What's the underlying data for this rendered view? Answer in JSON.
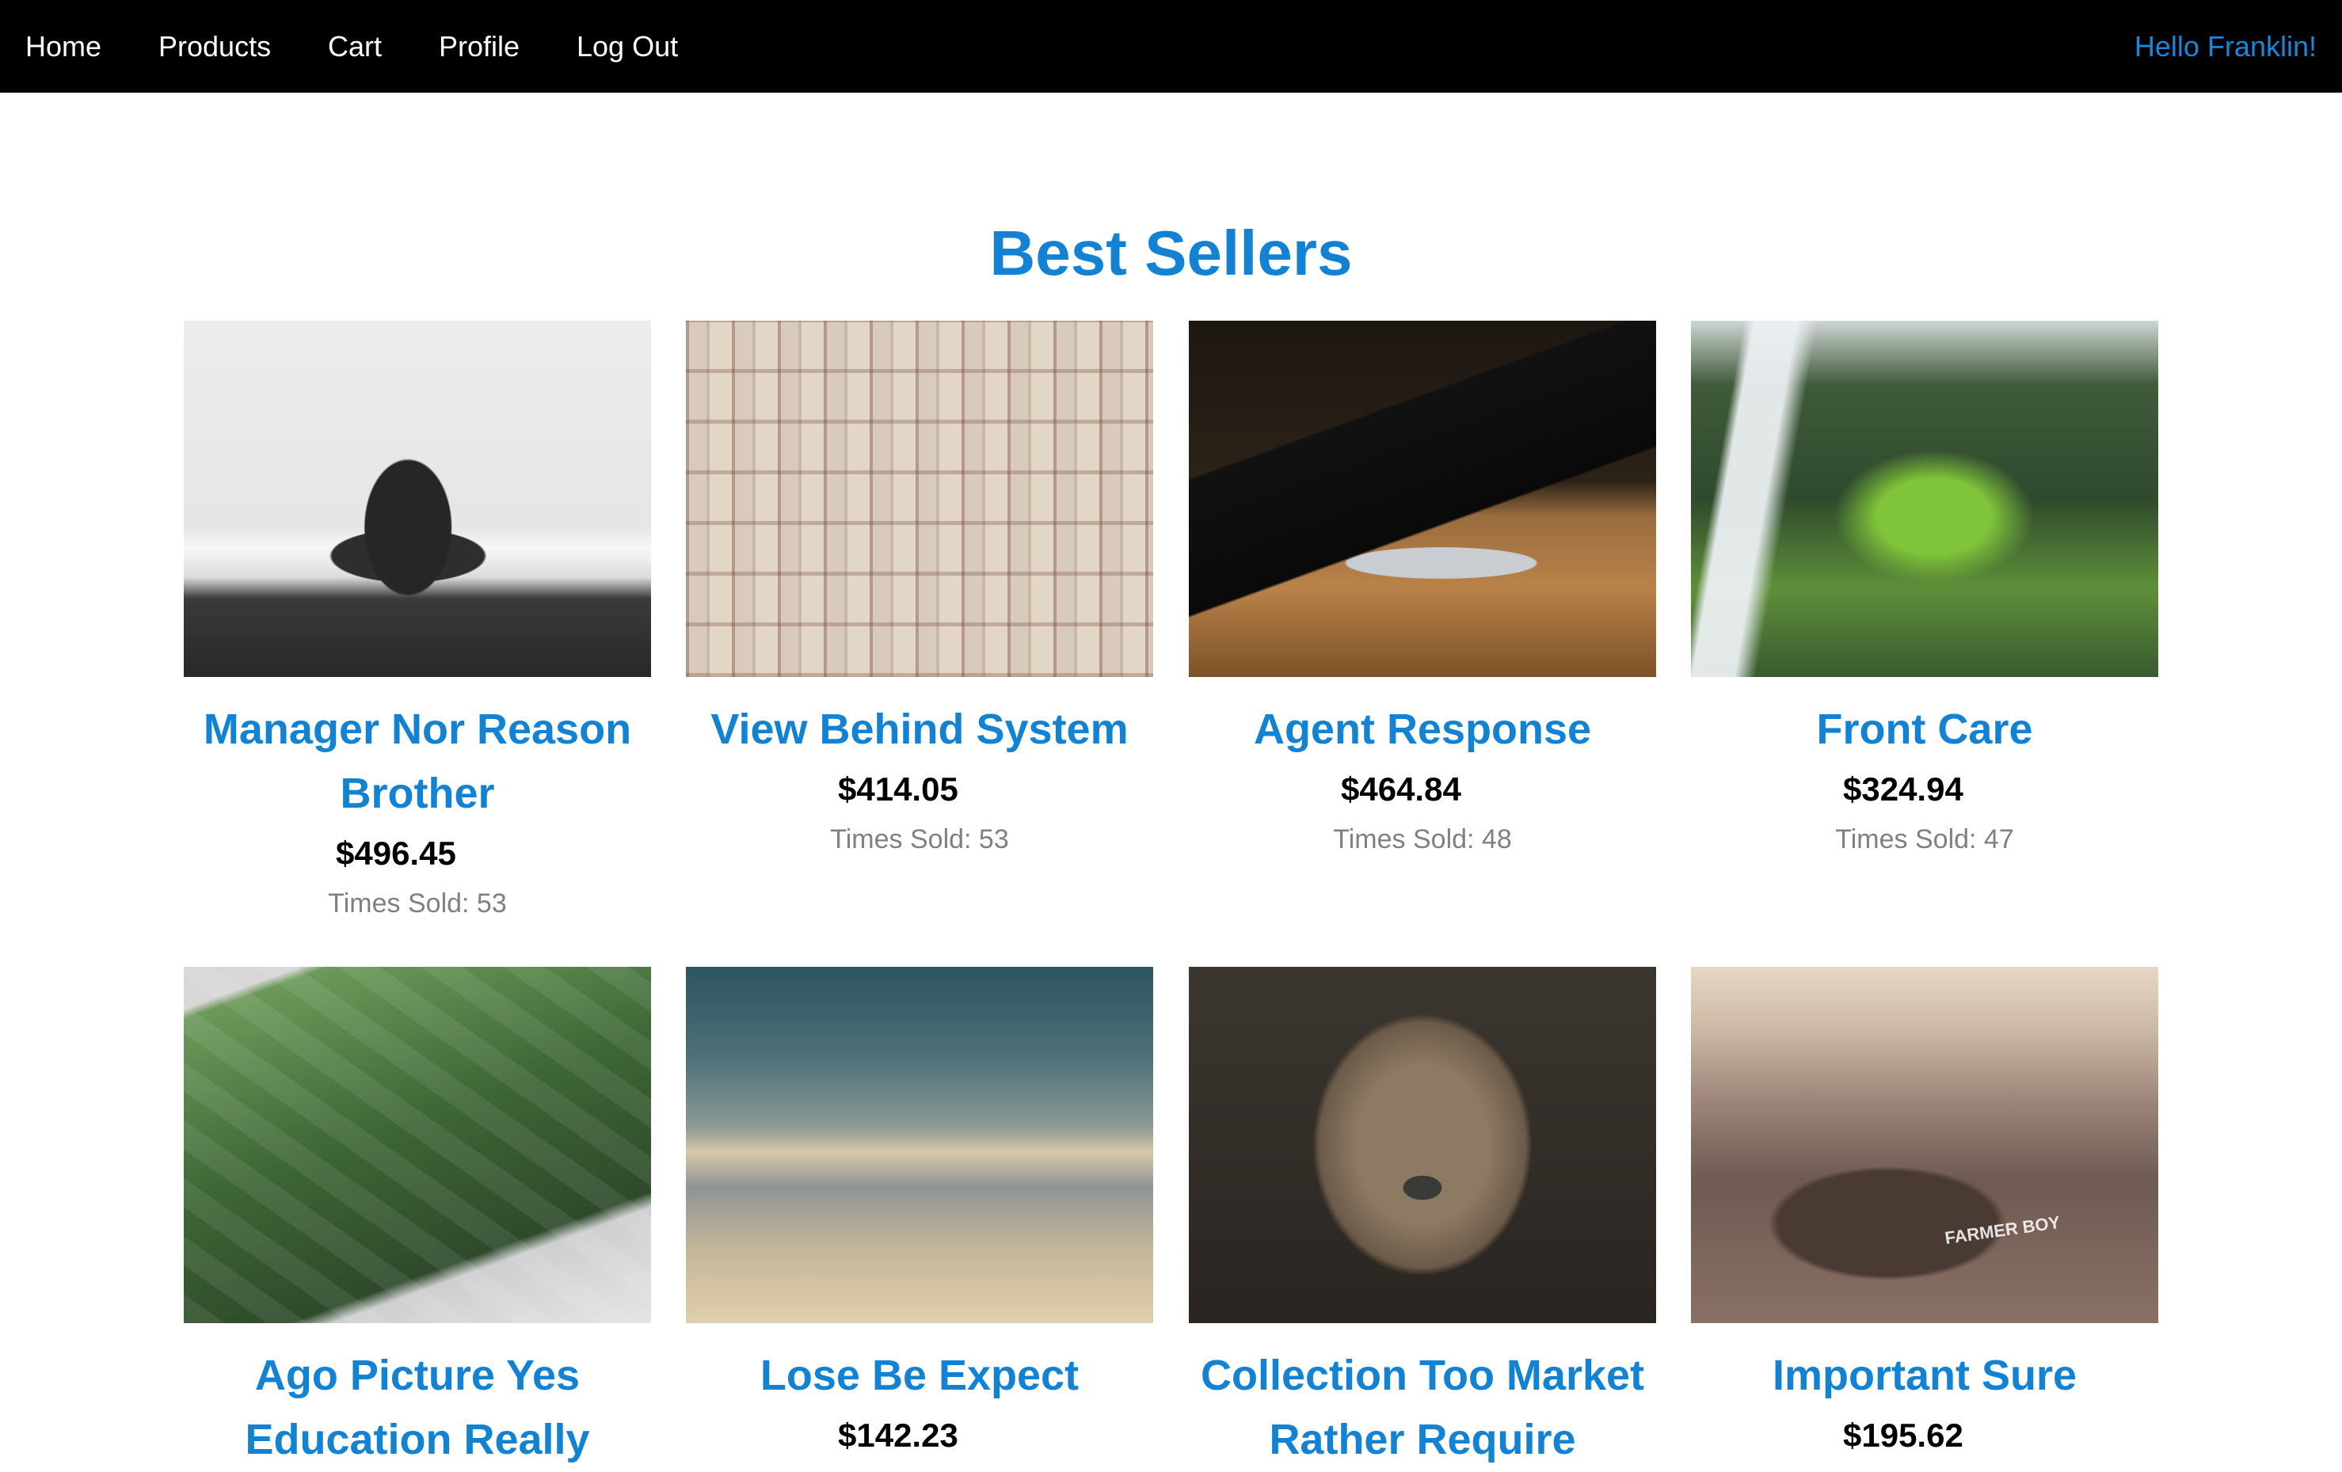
{
  "nav": {
    "links": [
      "Home",
      "Products",
      "Cart",
      "Profile",
      "Log Out"
    ],
    "greeting": "Hello Franklin!"
  },
  "section_title": "Best Sellers",
  "products": [
    {
      "name": "Manager Nor Reason Brother",
      "price": "$496.45",
      "times_sold": "Times Sold: 53",
      "image": "black rock sea stack on beach"
    },
    {
      "name": "View Behind System",
      "price": "$414.05",
      "times_sold": "Times Sold: 53",
      "image": "open books wall"
    },
    {
      "name": "Agent Response",
      "price": "$464.84",
      "times_sold": "Times Sold: 48",
      "image": "laptop on wooden desk"
    },
    {
      "name": "Front Care",
      "price": "$324.94",
      "times_sold": "Times Sold: 47",
      "image": "waterfall in green forest"
    },
    {
      "name": "Ago Picture Yes Education Really",
      "price": "",
      "times_sold": "",
      "image": "aerial football stadium"
    },
    {
      "name": "Lose Be Expect",
      "price": "$142.23",
      "times_sold": "",
      "image": "cloudy sky"
    },
    {
      "name": "Collection Too Market Rather Require",
      "price": "",
      "times_sold": "",
      "image": "lioness portrait"
    },
    {
      "name": "Important Sure",
      "price": "$195.62",
      "times_sold": "",
      "image": "vintage car",
      "image_text": "FARMER BOY"
    }
  ],
  "colors": {
    "navbar_bg": "#000000",
    "accent": "#1382d3",
    "muted_text": "#808080"
  }
}
